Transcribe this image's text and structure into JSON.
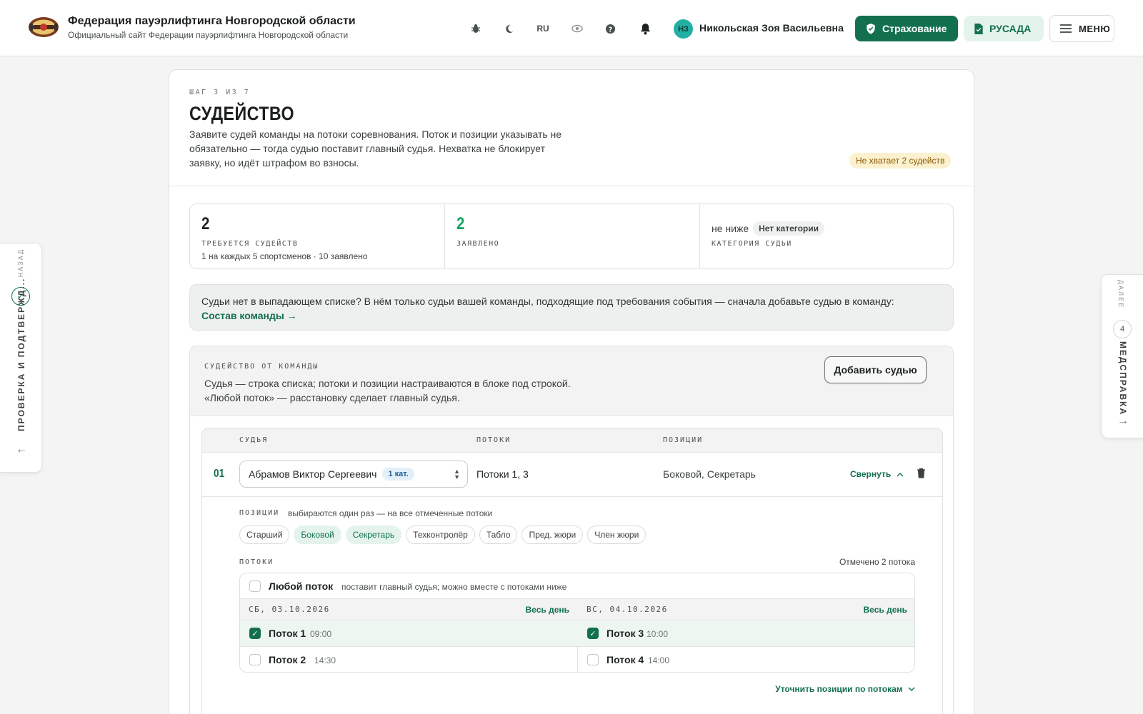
{
  "header": {
    "org_title": "Федерация пауэрлифтинга Новгородской области",
    "org_subtitle": "Официальный сайт Федерации пауэрлифтинга Новгородской области",
    "lang": "RU",
    "user_initials": "НЗ",
    "user_name": "Никольская Зоя Васильевна",
    "insurance_label": "Страхование",
    "rusada_label": "РУСАДА",
    "menu_label": "МЕНЮ"
  },
  "nav": {
    "back_caption": "НАЗАД",
    "back_title": "ПРОВЕРКА И ПОДТВЕРЖД...",
    "next_caption": "ДАЛЕЕ",
    "next_step": "4",
    "next_title": "МЕДСПРАВКА"
  },
  "page": {
    "step": "ШАГ 3 ИЗ 7",
    "title": "СУДЕЙСТВО",
    "description": "Заявите судей команды на потоки соревнования. Поток и позиции указывать не обязательно — тогда судью поставит главный судья. Нехватка не блокирует заявку, но идёт штрафом во взносы.",
    "warning": "Не хватает 2 судейств"
  },
  "stats": {
    "required_value": "2",
    "required_label": "ТРЕБУЕТСЯ СУДЕЙСТВ",
    "required_sub": "1 на каждых 5 спортсменов · 10 заявлено",
    "declared_value": "2",
    "declared_label": "ЗАЯВЛЕНО",
    "category_prefix": "не ниже",
    "category_value": "Нет категории",
    "category_label": "КАТЕГОРИЯ СУДЬИ"
  },
  "info": {
    "text": "Судьи нет в выпадающем списке? В нём только судьи вашей команды, подходящие под требования события — сначала добавьте судью в команду:",
    "link": "Состав команды →"
  },
  "team": {
    "caption": "СУДЕЙСТВО ОТ КОМАНДЫ",
    "desc_line1": "Судья — строка списка; потоки и позиции настраиваются в блоке под строкой.",
    "desc_line2": "«Любой поток» — расстановку сделает главный судья.",
    "add_label": "Добавить судью",
    "col_judge": "СУДЬЯ",
    "col_flows": "ПОТОКИ",
    "col_positions": "ПОЗИЦИИ"
  },
  "row": {
    "num": "01",
    "judge_name": "Абрамов Виктор Сергеевич",
    "judge_cat": "1 кат.",
    "flows": "Потоки 1, 3",
    "positions": "Боковой, Секретарь",
    "collapse_label": "Свернуть"
  },
  "detail": {
    "positions_caption": "ПОЗИЦИИ",
    "positions_hint": "выбираются один раз — на все отмеченные потоки",
    "chips": [
      {
        "label": "Старший",
        "on": false
      },
      {
        "label": "Боковой",
        "on": true
      },
      {
        "label": "Секретарь",
        "on": true
      },
      {
        "label": "Техконтролёр",
        "on": false
      },
      {
        "label": "Табло",
        "on": false
      },
      {
        "label": "Пред. жюри",
        "on": false
      },
      {
        "label": "Член жюри",
        "on": false
      }
    ],
    "flows_caption": "ПОТОКИ",
    "flows_count": "Отмечено 2 потока",
    "any_title": "Любой поток",
    "any_hint": "поставит главный судья; можно вместе с потоками ниже",
    "days": [
      {
        "date": "СБ, 03.10.2026",
        "all_label": "Весь день",
        "flows": [
          {
            "name": "Поток 1",
            "time": "09:00",
            "checked": true
          },
          {
            "name": "Поток 2",
            "time": "14:30",
            "checked": false
          }
        ]
      },
      {
        "date": "ВС, 04.10.2026",
        "all_label": "Весь день",
        "flows": [
          {
            "name": "Поток 3",
            "time": "10:00",
            "checked": true
          },
          {
            "name": "Поток 4",
            "time": "14:00",
            "checked": false
          }
        ]
      }
    ],
    "refine_label": "Уточнить позиции по потокам"
  },
  "colors": {
    "brand_green": "#13704f",
    "light_green": "#e4f4ec",
    "warning_bg": "#fbf1cf",
    "avatar": "#23b0a4"
  }
}
